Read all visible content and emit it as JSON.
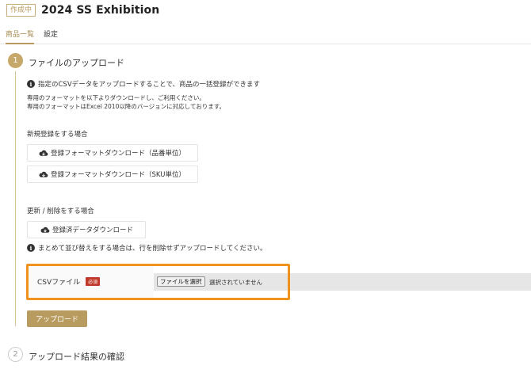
{
  "header": {
    "badge": "作成中",
    "title": "2024 SS Exhibition"
  },
  "tabs": [
    {
      "label": "商品一覧",
      "active": true
    },
    {
      "label": "設定",
      "active": false
    }
  ],
  "steps": [
    {
      "number": "1",
      "title": "ファイルのアップロード"
    },
    {
      "number": "2",
      "title": "アップロード結果の確認"
    }
  ],
  "info": {
    "main": "指定のCSVデータをアップロードすることで、商品の一括登録ができます",
    "note1": "専用のフォーマットを以下よりダウンロードし、ご利用ください。",
    "note2": "専用のフォーマットはExcel 2010以降のバージョンに対応しております。"
  },
  "new_registration": {
    "label": "新規登録をする場合",
    "buttons": [
      "登録フォーマットダウンロード（品番単位）",
      "登録フォーマットダウンロード（SKU単位）"
    ]
  },
  "update_delete": {
    "label": "更新 / 削除をする場合",
    "button": "登録済データダウンロード",
    "warning": "まとめて並び替えをする場合は、行を削除せずアップロードしてください。"
  },
  "csv_field": {
    "label": "CSVファイル",
    "required": "必須",
    "choose_button": "ファイルを選択",
    "status": "選択されていません"
  },
  "upload_button": "アップロード",
  "colors": {
    "accent": "#b79b5f",
    "highlight": "#f0921e",
    "required": "#c0392b"
  },
  "icons": [
    "info-icon",
    "cloud-download-icon"
  ]
}
